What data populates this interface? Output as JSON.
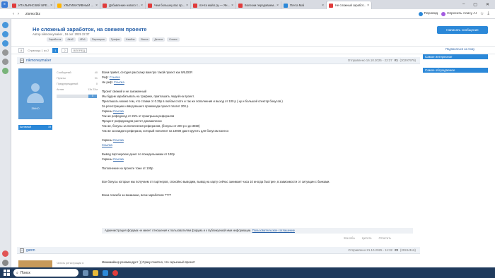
{
  "browser": {
    "tabs": [
      {
        "label": "ИТАЛЬЯНСКИЙ БРЕЙНР...",
        "color": "#e03b3b"
      },
      {
        "label": "УЛЬТИМАТИВНЫЙ БРЕЙ...",
        "color": "#ffb400"
      },
      {
        "label": "Добавление нового т...",
        "color": "#e03b3b"
      },
      {
        "label": "Чем большеу вас пр...",
        "color": "#e03b3b"
      },
      {
        "label": "почта майл ру — Янде...",
        "color": "#e03b3b"
      },
      {
        "label": "Болезни передаваем...",
        "color": "#e03b3b"
      },
      {
        "label": "Почта Mail",
        "color": "#2b88d8"
      },
      {
        "label": "Не сложный заработ...",
        "color": "#e03b3b"
      }
    ],
    "url": "zismo.biz",
    "translate_label": "Перевод",
    "alice_label": "Спросить Алису AI"
  },
  "topic": {
    "title": "Не сложный заработок, на свежем проекте",
    "meta": "Автор nikmoneymaker , 16 окт. 2025 22:37",
    "tags": [
      "Заработок",
      "Airb2",
      "4Pz1",
      "Партнерка",
      "Трафик",
      "Кэшбэк",
      "Висса",
      "Деньги",
      "Снтикс"
    ],
    "reply_button": "Написать сообщение",
    "subscribe": "Подписаться на тему",
    "counter": "8",
    "pages_label": "Страница 1 из 2",
    "pages": [
      "1",
      "2"
    ],
    "next": "ВПЕРЕД"
  },
  "sidebar_right": {
    "boxes": [
      "Самое интересное",
      "Самое обсуждаемое"
    ]
  },
  "post1": {
    "author": "nikmoneymaker",
    "date": "Отправлено 16.10.2025 - 22:37",
    "num": "#1",
    "id": "(20297979)",
    "avatar_label": "25bNO",
    "rank": "Активный",
    "rank_num": "19",
    "stats": [
      {
        "label": "Сообщений",
        "value": "40"
      },
      {
        "label": "Пункты",
        "value": "91"
      },
      {
        "label": "Предупреждений",
        "value": "0"
      },
      {
        "label": "Актив",
        "value": "13к 22м"
      }
    ],
    "bar_value": "0",
    "lines": [
      {
        "t": "Всем привет, сегодня расскажу вам про такой проект как WILDER"
      },
      {
        "t": "Реф: ",
        "link": "Ссылка"
      },
      {
        "t": "Не реф: ",
        "link": "Ссылка"
      },
      {
        "gap": true
      },
      {
        "t": "Проект свежий и не заезженный"
      },
      {
        "t": "Мы будем зарабатывать на трафике, приглашать людей на проект."
      },
      {
        "t": "Приглашать можно тем, что ставки от 0.35р в любом слоте и так же пополнения и выход от 100 р ( ну и большой спектор бонусов )"
      },
      {
        "t": "За регистрацию и ввод вашего промокода проект платит 200 р"
      },
      {
        "t": "Скрины ",
        "link": "Ссылка"
      },
      {
        "t": "Так же рефодоход от 25% от проигрыша рефералов"
      },
      {
        "t": "Процент рефодоходов растет динамически"
      },
      {
        "t": "Так же, бонусы за пополнения рефералов, (бонусы от 200 р и до 3650)"
      },
      {
        "t": "Так же за каждого реферала, который пополнит на 10000 дают крутить для бонусом колесо"
      },
      {
        "gap": true
      },
      {
        "t": "Скрины ",
        "link": "Ссылка"
      },
      {
        "t": "",
        "link": "Ссылка"
      },
      {
        "gap": true
      },
      {
        "t": "Вывод партнерских денег по понедельникам от 100р"
      },
      {
        "t": "Скрины ",
        "link": "Ссылка"
      },
      {
        "gap": true
      },
      {
        "t": "Пополнение на проекте тоже от 100р"
      },
      {
        "gap": true
      },
      {
        "gap": true
      },
      {
        "t": "Все бонусы которые мы получаем от партнеров, спокойно выводим, вывод на карту сейчас занимает часа 10 иногда быстрее, в зависимости от ситуации с банками."
      },
      {
        "gap": true
      },
      {
        "gap": true
      },
      {
        "t": "Всем спасибо за внимание, всем заработков ????"
      }
    ],
    "disclaimer": "Администрация форума не имеет отношения к пользователям форума и к публикуемой ими информации.",
    "disclaimer_link": "Пользовательское соглашение",
    "actions": [
      "Жалоба",
      "Цитата",
      "Ответить"
    ]
  },
  "post2": {
    "author": "ganm",
    "date": "Отправлено 21.10.2025 - 11:32",
    "num": "#2",
    "id": "(20244116)",
    "info": "Читать регистрации в",
    "text": "Минимайнер рекомендует :)) Сразу понятно, что серьезный проект!"
  },
  "taskbar": {
    "search_placeholder": "Поиск"
  },
  "watermark": "TZOVIKON.COM"
}
